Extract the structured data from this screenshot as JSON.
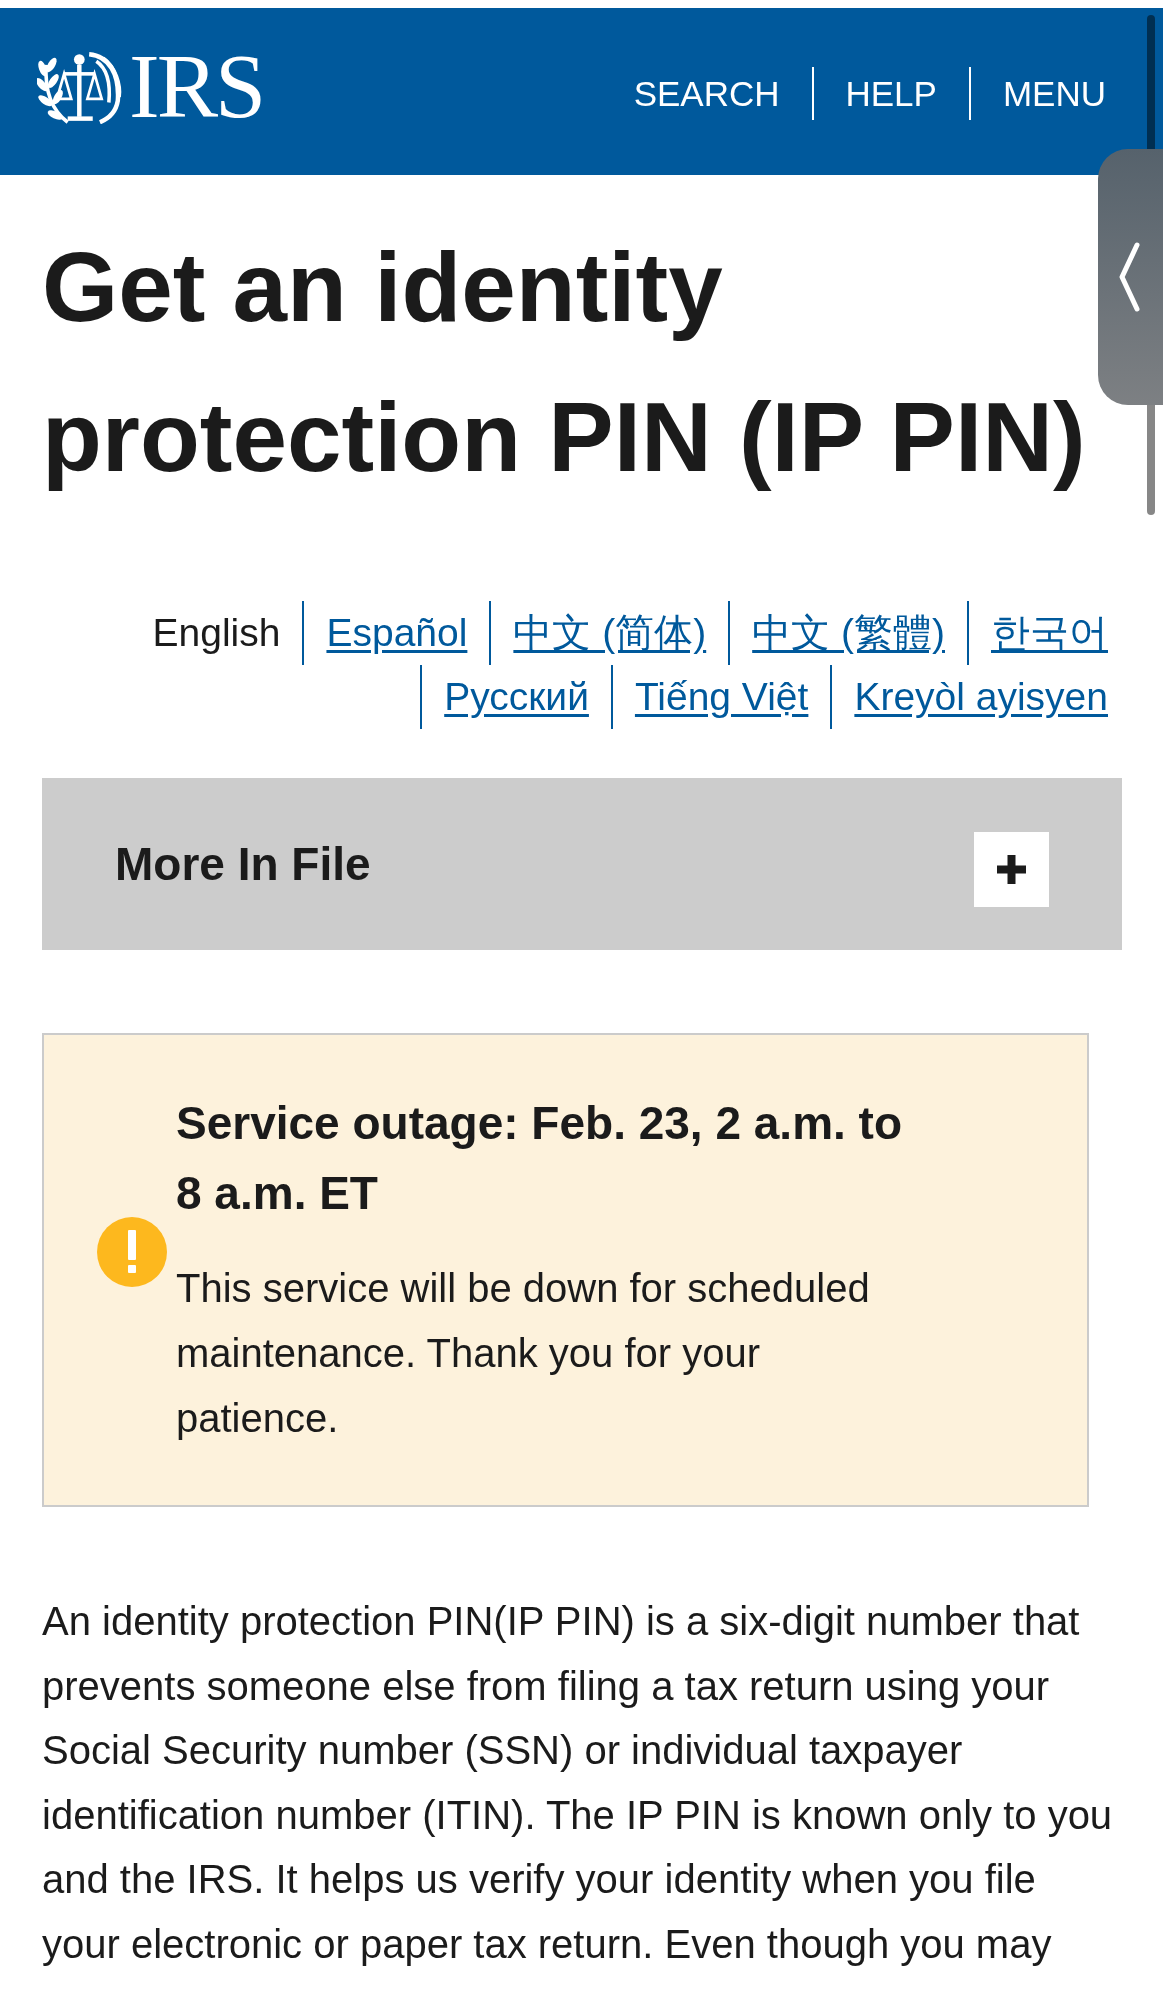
{
  "header": {
    "logo_text": "IRS",
    "nav": [
      "SEARCH",
      "HELP",
      "MENU"
    ]
  },
  "title": "Get an identity protection PIN (IP PIN)",
  "languages": [
    {
      "label": "English",
      "selected": true
    },
    {
      "label": "Español",
      "selected": false
    },
    {
      "label": "中文 (简体)",
      "selected": false
    },
    {
      "label": "中文 (繁體)",
      "selected": false
    },
    {
      "label": "한국어",
      "selected": false
    },
    {
      "label": "Русский",
      "selected": false
    },
    {
      "label": "Tiếng Việt",
      "selected": false
    },
    {
      "label": "Kreyòl ayisyen",
      "selected": false
    }
  ],
  "more_in_file": {
    "label": "More In File",
    "expanded": false
  },
  "alert": {
    "heading": "Service outage: Feb. 23, 2 a.m. to 8 a.m. ET",
    "body": "This service will be down for scheduled maintenance. Thank you for your patience."
  },
  "intro": "An identity protection PIN(IP PIN) is a six-digit number that prevents someone else from filing a tax return using your Social Security number (SSN) or individual taxpayer identification number (ITIN). The IP PIN is known only to you and the IRS. It helps us verify your identity when you file your electronic or paper tax return. Even though you may"
}
